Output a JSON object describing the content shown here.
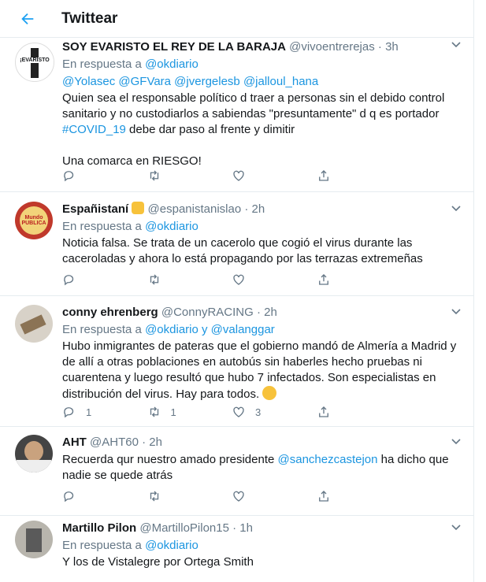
{
  "header": {
    "title": "Twittear"
  },
  "tweets": [
    {
      "name": "SOY EVARISTO EL REY DE LA BARAJA",
      "handle": "@vivoentrerejas",
      "time": "3h",
      "reply_prefix": "En respuesta a",
      "reply_to": "@okdiario",
      "mentions": "@Yolasec @GFVara @jvergelesb @jalloul_hana",
      "text_a": "Quien sea el responsable político d traer a personas sin el debido control sanitario y no custodiarlos a sabiendas \"presuntamente\" d q es portador",
      "hashtag": "#COVID_19",
      "text_b": " debe dar paso al frente y dimitir",
      "text_c": "Una comarca en RIESGO!"
    },
    {
      "name": "Españistaní",
      "handle": "@espanistanislao",
      "time": "2h",
      "reply_prefix": "En respuesta a",
      "reply_to": "@okdiario",
      "text": "Noticia falsa. Se trata de un cacerolo que cogió el virus durante las caceroladas y ahora lo está propagando por las terrazas extremeñas"
    },
    {
      "name": "conny ehrenberg",
      "handle": "@ConnyRACING",
      "time": "2h",
      "reply_prefix": "En respuesta a",
      "reply_to": "@okdiario y @valanggar",
      "text": "Hubo inmigrantes de pateras que el gobierno mandó de Almería a Madrid y de allí a otras poblaciones en autobús sin haberles hecho pruebas ni cuarentena y luego resultó que hubo 7 infectados. Son especialistas en distribución del virus. Hay para todos.",
      "replies": "1",
      "retweets": "1",
      "likes": "3"
    },
    {
      "name": "AHT",
      "handle": "@AHT60",
      "time": "2h",
      "text_a": "Recuerda qur nuestro amado presidente ",
      "mention": "@sanchezcastejon",
      "text_b": " ha dicho que nadie se quede atrás"
    },
    {
      "name": "Martillo Pilon",
      "handle": "@MartilloPilon15",
      "time": "1h",
      "reply_prefix": "En respuesta a",
      "reply_to": "@okdiario",
      "text": "Y los de Vistalegre por Ortega Smith"
    }
  ],
  "avatar_texts": {
    "t1": "¡EVARISTO",
    "t2": "Mundo PUBLICA"
  },
  "colors": {
    "link": "#1b95e0",
    "muted": "#657786",
    "border": "#e6ecf0"
  }
}
